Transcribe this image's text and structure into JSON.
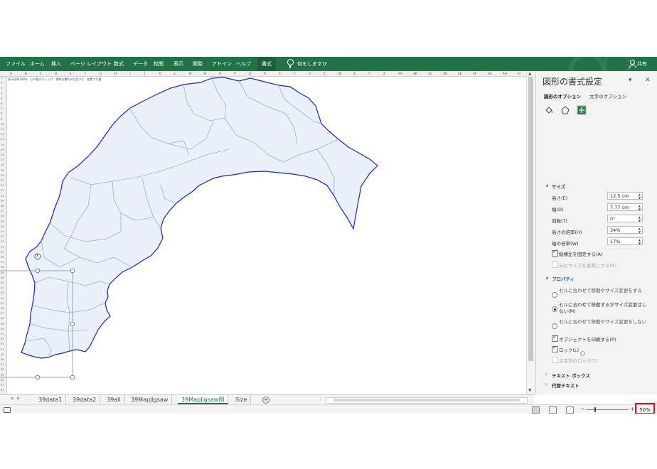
{
  "ribbon": {
    "tabs": [
      "ファイル",
      "ホーム",
      "挿入",
      "ページ レイアウト",
      "数式",
      "データ",
      "校閲",
      "表示",
      "開発",
      "アドイン",
      "ヘルプ"
    ],
    "active_tab": "書式",
    "tell_me": "何をしますか",
    "share": "共有",
    "bg_color": "#217346"
  },
  "sheet": {
    "columns": [
      "A",
      "B",
      "C",
      "D",
      "E",
      "F",
      "G",
      "H",
      "I",
      "J",
      "K",
      "L",
      "M",
      "N",
      "O",
      "P",
      "Q",
      "R",
      "S",
      "T",
      "U",
      "V",
      "W",
      "X",
      "Y",
      "Z",
      "AA",
      "AB",
      "AC",
      "AD",
      "AE",
      "AF",
      "AG",
      "AH",
      "AI"
    ],
    "note": "表示倍率100%　セル幅チチェック　透明な書式デ回点クオ　拡散で引量",
    "map_fill": "#eaf1fa",
    "map_stroke": "#1f1fd8",
    "border_color": "#8fb3e3"
  },
  "pane": {
    "title": "図形の書式設定",
    "tab_shape": "図形のオプション",
    "tab_text": "文字のオプション",
    "size_section": "サイズ",
    "height_label": "高さ(E)",
    "height_value": "12.5 cm",
    "width_label": "幅(D)",
    "width_value": "7.77 cm",
    "rotation_label": "回転(T)",
    "rotation_value": "0°",
    "scale_h_label": "高さの倍率(H)",
    "scale_h_value": "34%",
    "scale_w_label": "幅の倍率(W)",
    "scale_w_value": "17%",
    "lock_aspect": "縦横比を固定する(A)",
    "relative_original": "元のサイズを基準にする(R)",
    "properties_section": "プロパティ",
    "radio1": "セルに合わせて移動やサイズ変更をする(S)",
    "radio2": "セルに合わせて移動するがサイズ変更はしない(M)",
    "radio3": "セルに合わせて移動やサイズ変更をしない(D)",
    "print_object": "オブジェクトを印刷する(P)",
    "lock": "ロック(L)",
    "lock_text": "文字列のロック(T)",
    "textbox_section": "テキスト ボックス",
    "alt_text_section": "代替テキスト"
  },
  "sheet_tabs": [
    "39data1",
    "39data2",
    "39all",
    "39MapJigsaw",
    "39MapJigsaw例",
    "Size"
  ],
  "active_sheet": "39MapJigsaw例",
  "status": {
    "zoom": "50%",
    "highlight_color": "#e0101a"
  }
}
